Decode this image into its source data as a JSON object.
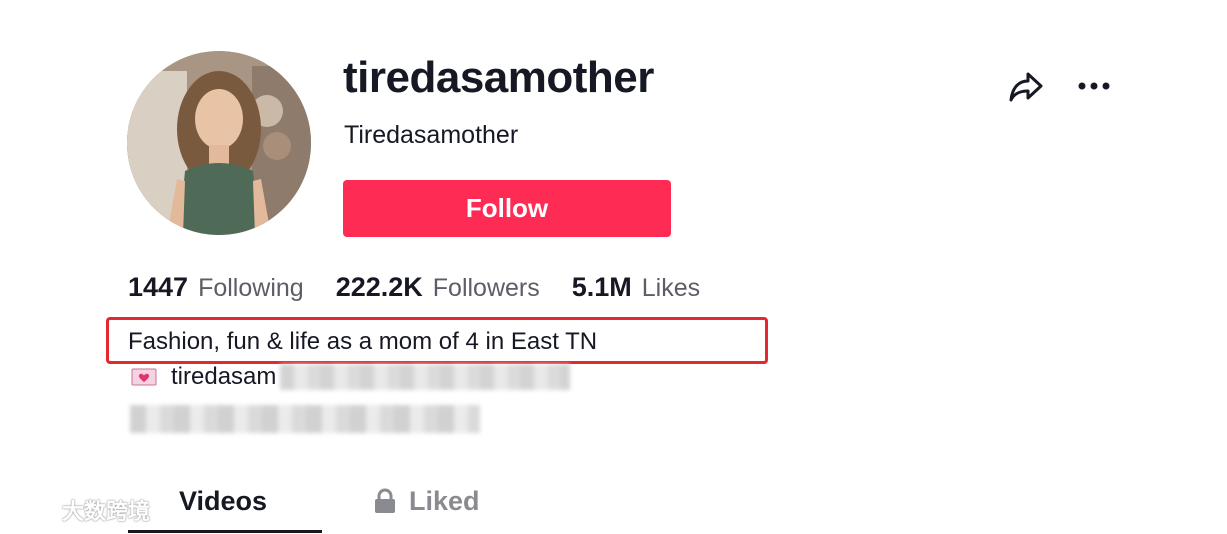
{
  "profile": {
    "username": "tiredasamother",
    "nickname": "Tiredasamother",
    "follow_label": "Follow"
  },
  "stats": [
    {
      "value": "1447",
      "label": "Following"
    },
    {
      "value": "222.2K",
      "label": "Followers"
    },
    {
      "value": "5.1M",
      "label": "Likes"
    }
  ],
  "bio": {
    "line1": "Fashion, fun & life as a mom of 4 in East TN",
    "email_visible": "tiredasam"
  },
  "tabs": {
    "videos": "Videos",
    "liked": "Liked"
  },
  "watermark": {
    "text": "大数跨境"
  },
  "icons": {
    "share": "share-icon",
    "more": "more-icon",
    "lock": "lock-icon",
    "heart_letter": "love-letter-icon"
  },
  "colors": {
    "follow_button": "#fe2c55",
    "highlight_box": "#e3282e",
    "text_primary": "#161823",
    "text_secondary": "#5c5e66"
  }
}
